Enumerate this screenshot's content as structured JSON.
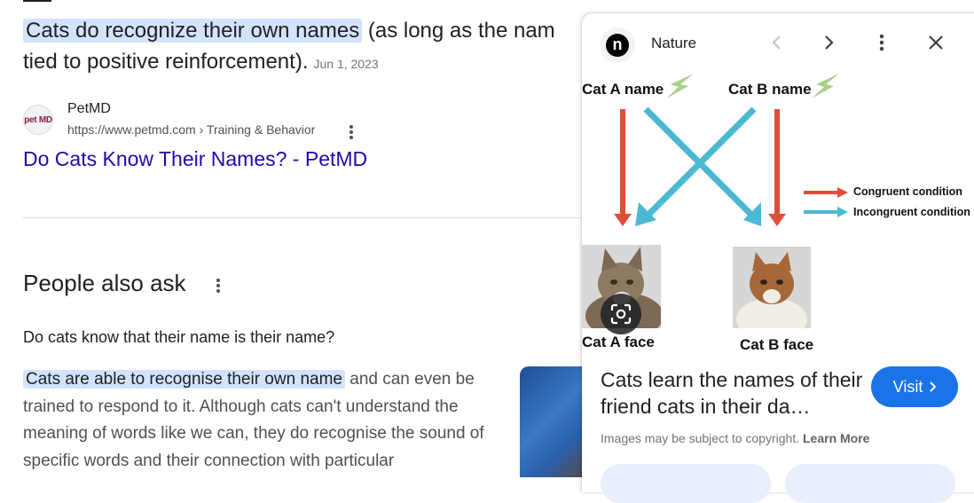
{
  "snippet": {
    "highlight": "Cats do recognize their own names",
    "text_line1": " (as long as the nam",
    "text_line2": "tied to positive reinforcement).",
    "date": "Jun 1, 2023"
  },
  "source": {
    "favicon_text": "pet MD",
    "name": "PetMD",
    "url": "https://www.petmd.com › Training & Behavior",
    "title": "Do Cats Know Their Names? - PetMD"
  },
  "people_also_ask": {
    "title": "People also ask",
    "question": "Do cats know that their name is their name?",
    "answer_highlight": "Cats are able to recognise their own name",
    "answer_rest": " and can even be trained to respond to it. Although cats can't understand the meaning of words like we can, they do recognise the sound of specific words and their connection with particular"
  },
  "panel": {
    "source_logo": "n",
    "source_name": "Nature",
    "figure": {
      "cat_a_name": "Cat A name",
      "cat_b_name": "Cat B name",
      "congruent": "Congruent condition",
      "incongruent": "Incongruent condition",
      "cat_a_face": "Cat A face",
      "cat_b_face": "Cat B face",
      "congruent_color": "#e04e39",
      "incongruent_color": "#4cb8d4",
      "lightning_color": "#a8d08d"
    },
    "title": "Cats learn the names of their friend cats in their da…",
    "visit_label": "Visit",
    "copyright": "Images may be subject to copyright.",
    "learn_more": "Learn More"
  },
  "icons": {
    "prev": "chevron-left-icon",
    "next": "chevron-right-icon",
    "more": "more-vert-icon",
    "close": "close-icon",
    "lens": "lens-icon"
  }
}
